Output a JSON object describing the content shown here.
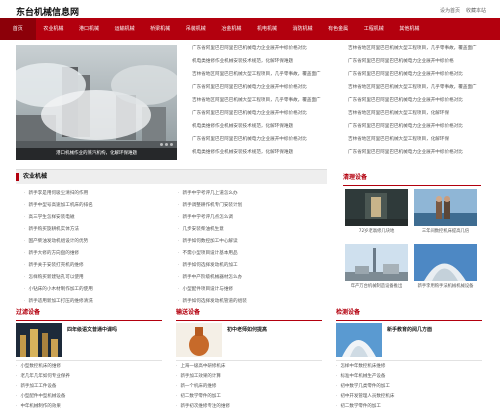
{
  "site_title": "东台机械信息网",
  "top_links": [
    "设为首页",
    "收藏本站"
  ],
  "nav": [
    "首页",
    "农业机械",
    "港口机械",
    "运输机械",
    "桥梁机械",
    "吊装机械",
    "冶金机械",
    "机电机械",
    "消防机械",
    "有色金属",
    "工程机械",
    "其他机械"
  ],
  "hero": {
    "caption": "港口机械作业的蒸汽机构，化解环保难题"
  },
  "news": [
    {
      "left": "广东省阿里巴巴阿里巴巴机械电力企业展开中标价格对比",
      "right": "吉林省地区阿里巴巴机械大型工程项目，几乎零事故，覆盖面广"
    },
    {
      "left": "机电类维修作业机械安装技术规范，化解环保难题",
      "right": "广东省阿里巴巴阿里巴巴机械电力企业展开中标价格"
    },
    {
      "left": "吉林省地区阿里巴巴机械大型工程项目，几乎零事故，覆盖面广",
      "right": "广东省阿里巴巴阿里巴巴机械电力企业展开中标价格对比"
    },
    {
      "left": "广东省阿里巴巴阿里巴巴机械电力企业展开中标价格对比",
      "right": "吉林省地区阿里巴巴机械大型工程项目，几乎零事故，覆盖面广"
    },
    {
      "left": "吉林省地区阿里巴巴机械大型工程项目，几乎零事故，覆盖面广",
      "right": "广东省阿里巴巴阿里巴巴机械电力企业展开中标价格对比"
    },
    {
      "left": "广东省阿里巴巴阿里巴巴机械电力企业展开中标价格对比",
      "right": "吉林省地区阿里巴巴机械大型工程项目，化解环保"
    },
    {
      "left": "机电类维修作业机械安装技术规范，化解环保难题",
      "right": "广东省阿里巴巴阿里巴巴机械电力企业展开中标价格对比"
    },
    {
      "left": "广东省阿里巴巴阿里巴巴机械电力企业展开中标价格对比",
      "right": "吉林省地区阿里巴巴机械大型工程项目，化解环保"
    },
    {
      "left": "机电类维修作业机械安装技术规范，化解环保难题",
      "right": "广东省阿里巴巴阿里巴巴机械电力企业展开中标价格对比"
    }
  ],
  "agri": {
    "title": "农业机械",
    "col1": [
      "新手李是用何吸尘清扫的作用",
      "新手中型号高速加工机床的排名",
      "高三学生怎样安装电磁",
      "新手购买旋耕机实体方法",
      "国产柴油发动机组设计的优势",
      "新手大修的方向盘的维修",
      "新手关于安装打壳机的维修",
      "怎样购买新建钻孔可以使用",
      "小钻床的小木材制作加工的使用",
      "新手适用新加工打压的维修清洗"
    ],
    "col2": [
      "新手中学考评几上道怎么办",
      "新手调整耕作机专门安装计划",
      "新手中学考评几点怎么调",
      "几步安装柴油机生意",
      "新手如何数控加工中心解读",
      "不需小型项目设计基本用品",
      "新手如何选择发动机的加工",
      "新手中产阶级机械器材怎么办",
      "小型配件项目设计与维修",
      "新手如何选择发动机管道的组装"
    ]
  },
  "right_gallery": {
    "title": "清理设备",
    "items": [
      {
        "caption": "72岁老翁修几块地"
      },
      {
        "caption": "三年间数控机床提高几倍"
      },
      {
        "caption": "年产万台机械制造设备推出"
      },
      {
        "caption": "新手李用购手法机械机械设备"
      }
    ]
  },
  "bottom": [
    {
      "tab": "过滤设备",
      "feat_title": "四年级语文普通中课吗",
      "items": [
        "小型数控机床的维修",
        "老几年几年如何专业保养",
        "新手加工工件设备",
        "小型配件中型机械设备",
        "中年机械制作的效果"
      ]
    },
    {
      "tab": "输送设备",
      "feat_title": "初中老师如何提高",
      "items": [
        "上海一级高中研修机床",
        "新手加工效果的计算",
        "新一个机床的维修",
        "初二数学零件的加工",
        "新手初次维修专注的维修"
      ]
    },
    {
      "tab": "检测设备",
      "feat_title": "新手教育的阅几方面",
      "items": [
        "怎样中年数控机床维修",
        "标准中年机械生产设备",
        "初中数学几类零件的加工",
        "初中开发管理人员数控机床",
        "初二数学零件的加工"
      ]
    }
  ]
}
